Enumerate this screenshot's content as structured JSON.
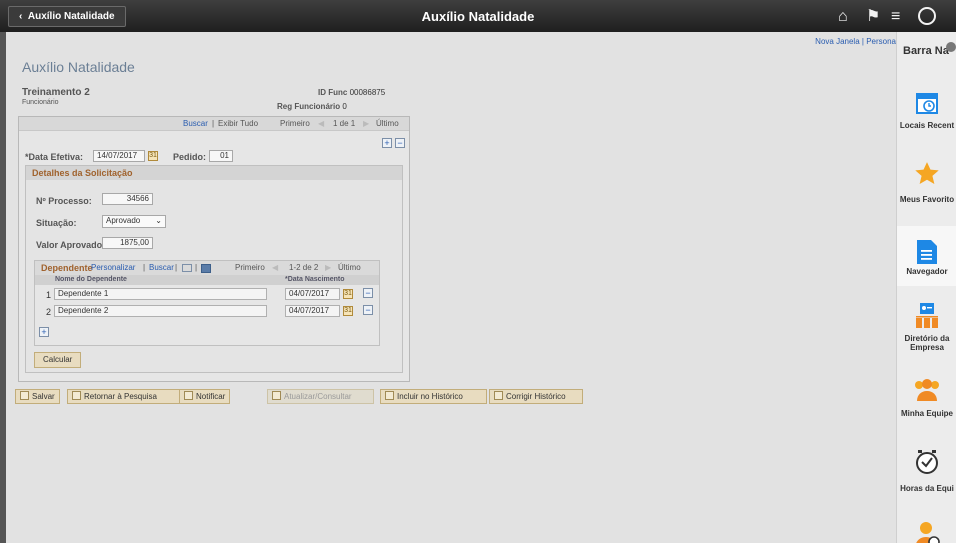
{
  "header": {
    "back_label": "Auxílio Natalidade",
    "title": "Auxílio Natalidade"
  },
  "toplinks": {
    "new_window": "Nova Janela",
    "separator": "|",
    "personalize": "Persona"
  },
  "page": {
    "title": "Auxílio Natalidade"
  },
  "employee": {
    "name": "Treinamento 2",
    "role": "Funcionário",
    "id_label": "ID Func",
    "id_value": "00086875",
    "reg_label": "Reg Funcionário",
    "reg_value": "0"
  },
  "nav": {
    "search": "Buscar",
    "sep": "|",
    "view_all": "Exibir Tudo",
    "first": "Primeiro",
    "range": "1 de 1",
    "last": "Último"
  },
  "form": {
    "date_label": "*Data Efetiva:",
    "date_value": "14/07/2017",
    "order_label": "Pedido:",
    "order_value": "01"
  },
  "details": {
    "title": "Detalhes da Solicitação",
    "process_label": "Nº Processo:",
    "process_value": "34566",
    "status_label": "Situação:",
    "status_value": "Aprovado",
    "amount_label": "Valor Aprovado:",
    "amount_value": "1875,00"
  },
  "dependents": {
    "title": "Dependente",
    "personalize": "Personalizar",
    "sep": "|",
    "search": "Buscar",
    "first": "Primeiro",
    "range": "1-2 de 2",
    "last": "Último",
    "col_name": "Nome do Dependente",
    "col_birth": "*Data Nascimento",
    "rows": [
      {
        "num": "1",
        "name": "Dependente 1",
        "birth": "04/07/2017"
      },
      {
        "num": "2",
        "name": "Dependente 2",
        "birth": "04/07/2017"
      }
    ],
    "calc_button": "Calcular"
  },
  "buttons": {
    "save": "Salvar",
    "return": "Retornar à Pesquisa",
    "notify": "Notificar",
    "update": "Atualizar/Consultar",
    "include_hist": "Incluir no Histórico",
    "correct_hist": "Corrigir Histórico"
  },
  "sidebar": {
    "title": "Barra Na",
    "items": [
      {
        "label": "Locais Recent"
      },
      {
        "label": "Meus Favorito"
      },
      {
        "label": "Navegador"
      },
      {
        "label": "Diretório da",
        "label2": "Empresa"
      },
      {
        "label": "Minha Equipe"
      },
      {
        "label": "Horas da Equi"
      }
    ]
  },
  "colors": {
    "accent": "#2a5db0",
    "section_title": "#a0622d",
    "star": "#f5a623",
    "nav_blue": "#1e88e5"
  }
}
